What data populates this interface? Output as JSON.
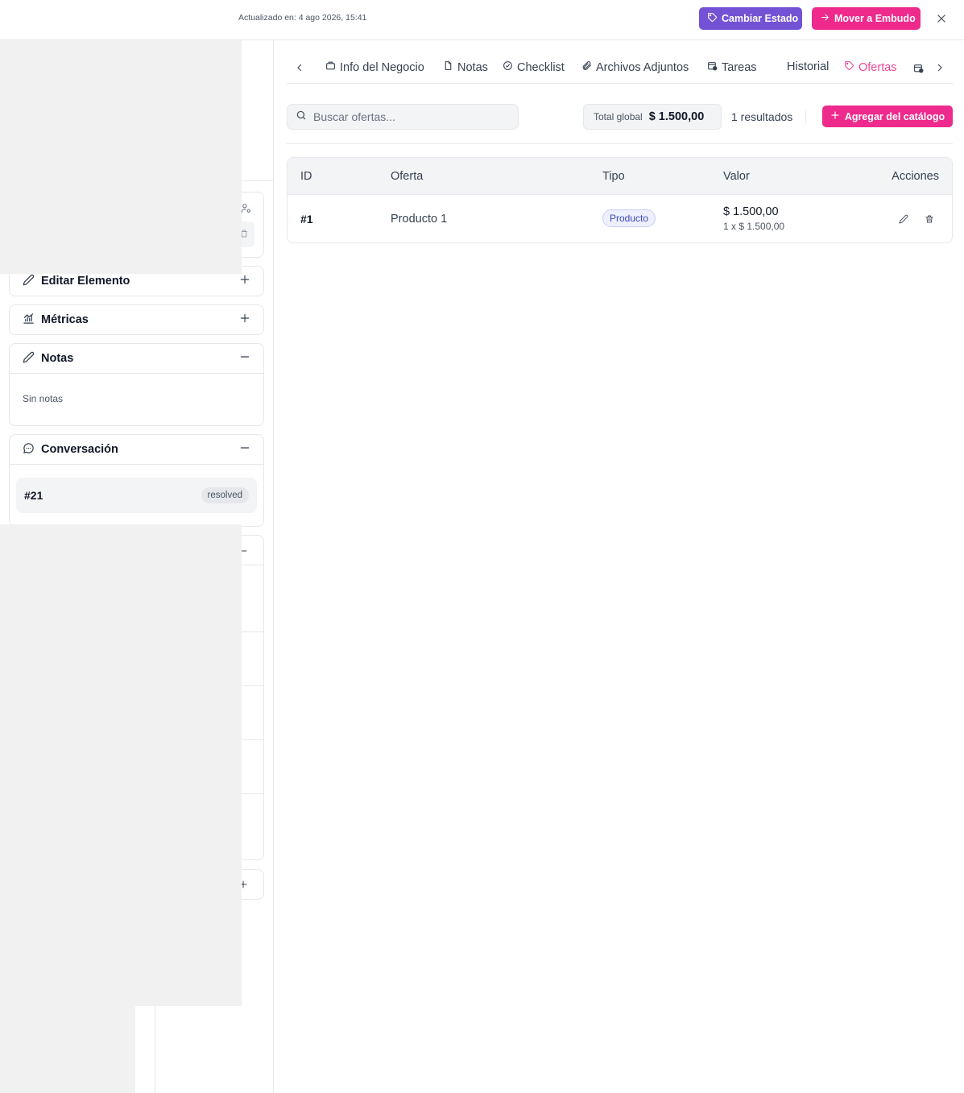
{
  "header": {
    "updated_text": "Actualizado en: 4 ago 2026, 15:41",
    "change_status_label": "Cambiar Estado",
    "move_funnel_label": "Mover a Embudo",
    "close_icon": "close-icon"
  },
  "sidebar": {
    "edit_label": "Editar Elemento",
    "metrics_label": "Métricas",
    "notes_label": "Notas",
    "notes_empty": "Sin notas",
    "conversation_label": "Conversación",
    "conversation": {
      "id": "#21",
      "status": "resolved"
    }
  },
  "tabs": [
    {
      "label": "Info del Negocio",
      "icon": "briefcase-icon"
    },
    {
      "label": "Notas",
      "icon": "file-icon"
    },
    {
      "label": "Checklist",
      "icon": "check-circle-icon"
    },
    {
      "label": "Archivos Adjuntos",
      "icon": "paperclip-icon"
    },
    {
      "label": "Tareas",
      "icon": "calendar-clock-icon"
    },
    {
      "label": "Historial",
      "icon": ""
    },
    {
      "label": "Ofertas",
      "icon": "tag-icon",
      "active": true
    }
  ],
  "toolbar": {
    "search_placeholder": "Buscar ofertas...",
    "total_label": "Total global",
    "total_value": "$ 1.500,00",
    "results_text": "1 resultados",
    "add_label": "Agregar del catálogo"
  },
  "table": {
    "columns": [
      "ID",
      "Oferta",
      "Tipo",
      "Valor",
      "Acciones"
    ],
    "rows": [
      {
        "id": "#1",
        "offer": "Producto 1",
        "type": "Producto",
        "value": "$ 1.500,00",
        "value_detail": "1 x $ 1.500,00"
      }
    ]
  },
  "colors": {
    "accent_pink": "#ee2a8c",
    "accent_purple": "#7452d6",
    "active_tab": "#ec4899"
  }
}
